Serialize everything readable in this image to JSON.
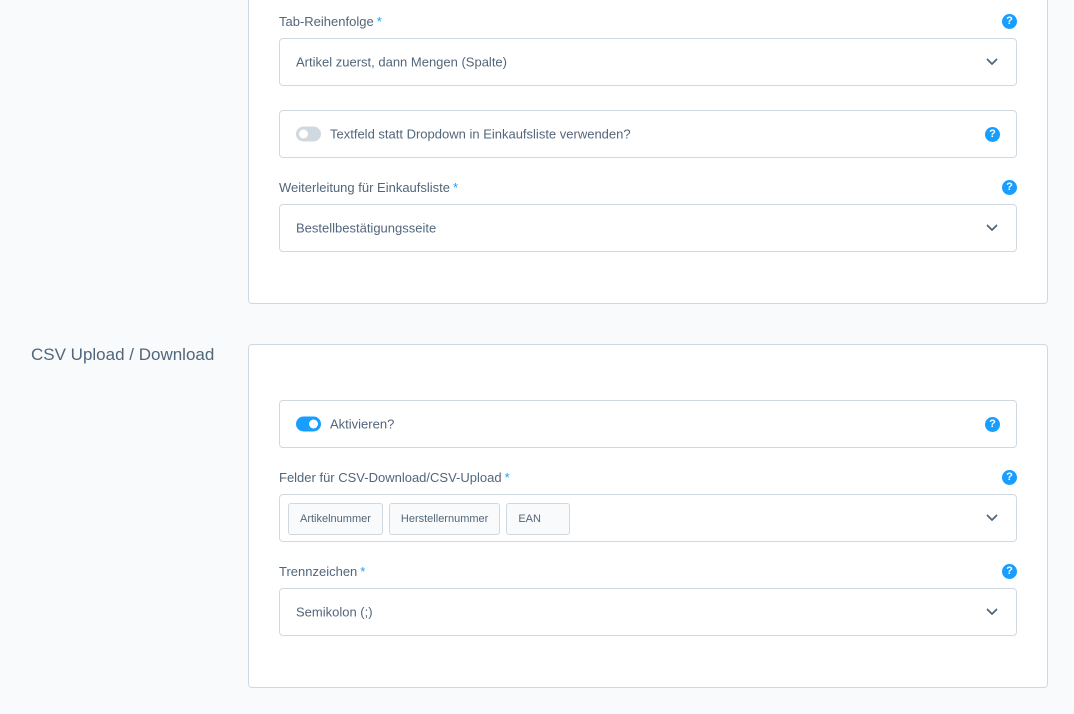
{
  "help_glyph": "?",
  "required_mark": "*",
  "colors": {
    "accent": "#189eff",
    "border": "#d1d9e0",
    "text": "#52667a",
    "background": "#f9fafb"
  },
  "card1": {
    "tab_order": {
      "label": "Tab-Reihenfolge",
      "value": "Artikel zuerst, dann Mengen (Spalte)"
    },
    "textfield_toggle": {
      "label": "Textfeld statt Dropdown in Einkaufsliste verwenden?",
      "checked": false
    },
    "redirect": {
      "label": "Weiterleitung für Einkaufsliste",
      "value": "Bestellbestätigungsseite"
    }
  },
  "csv_section": {
    "title": "CSV Upload / Download",
    "activate": {
      "label": "Aktivieren?",
      "checked": true
    },
    "fields": {
      "label": "Felder für CSV-Download/CSV-Upload",
      "tags": [
        "Artikelnummer",
        "Herstellernummer",
        "EAN"
      ]
    },
    "separator": {
      "label": "Trennzeichen",
      "value": "Semikolon (;)"
    }
  }
}
